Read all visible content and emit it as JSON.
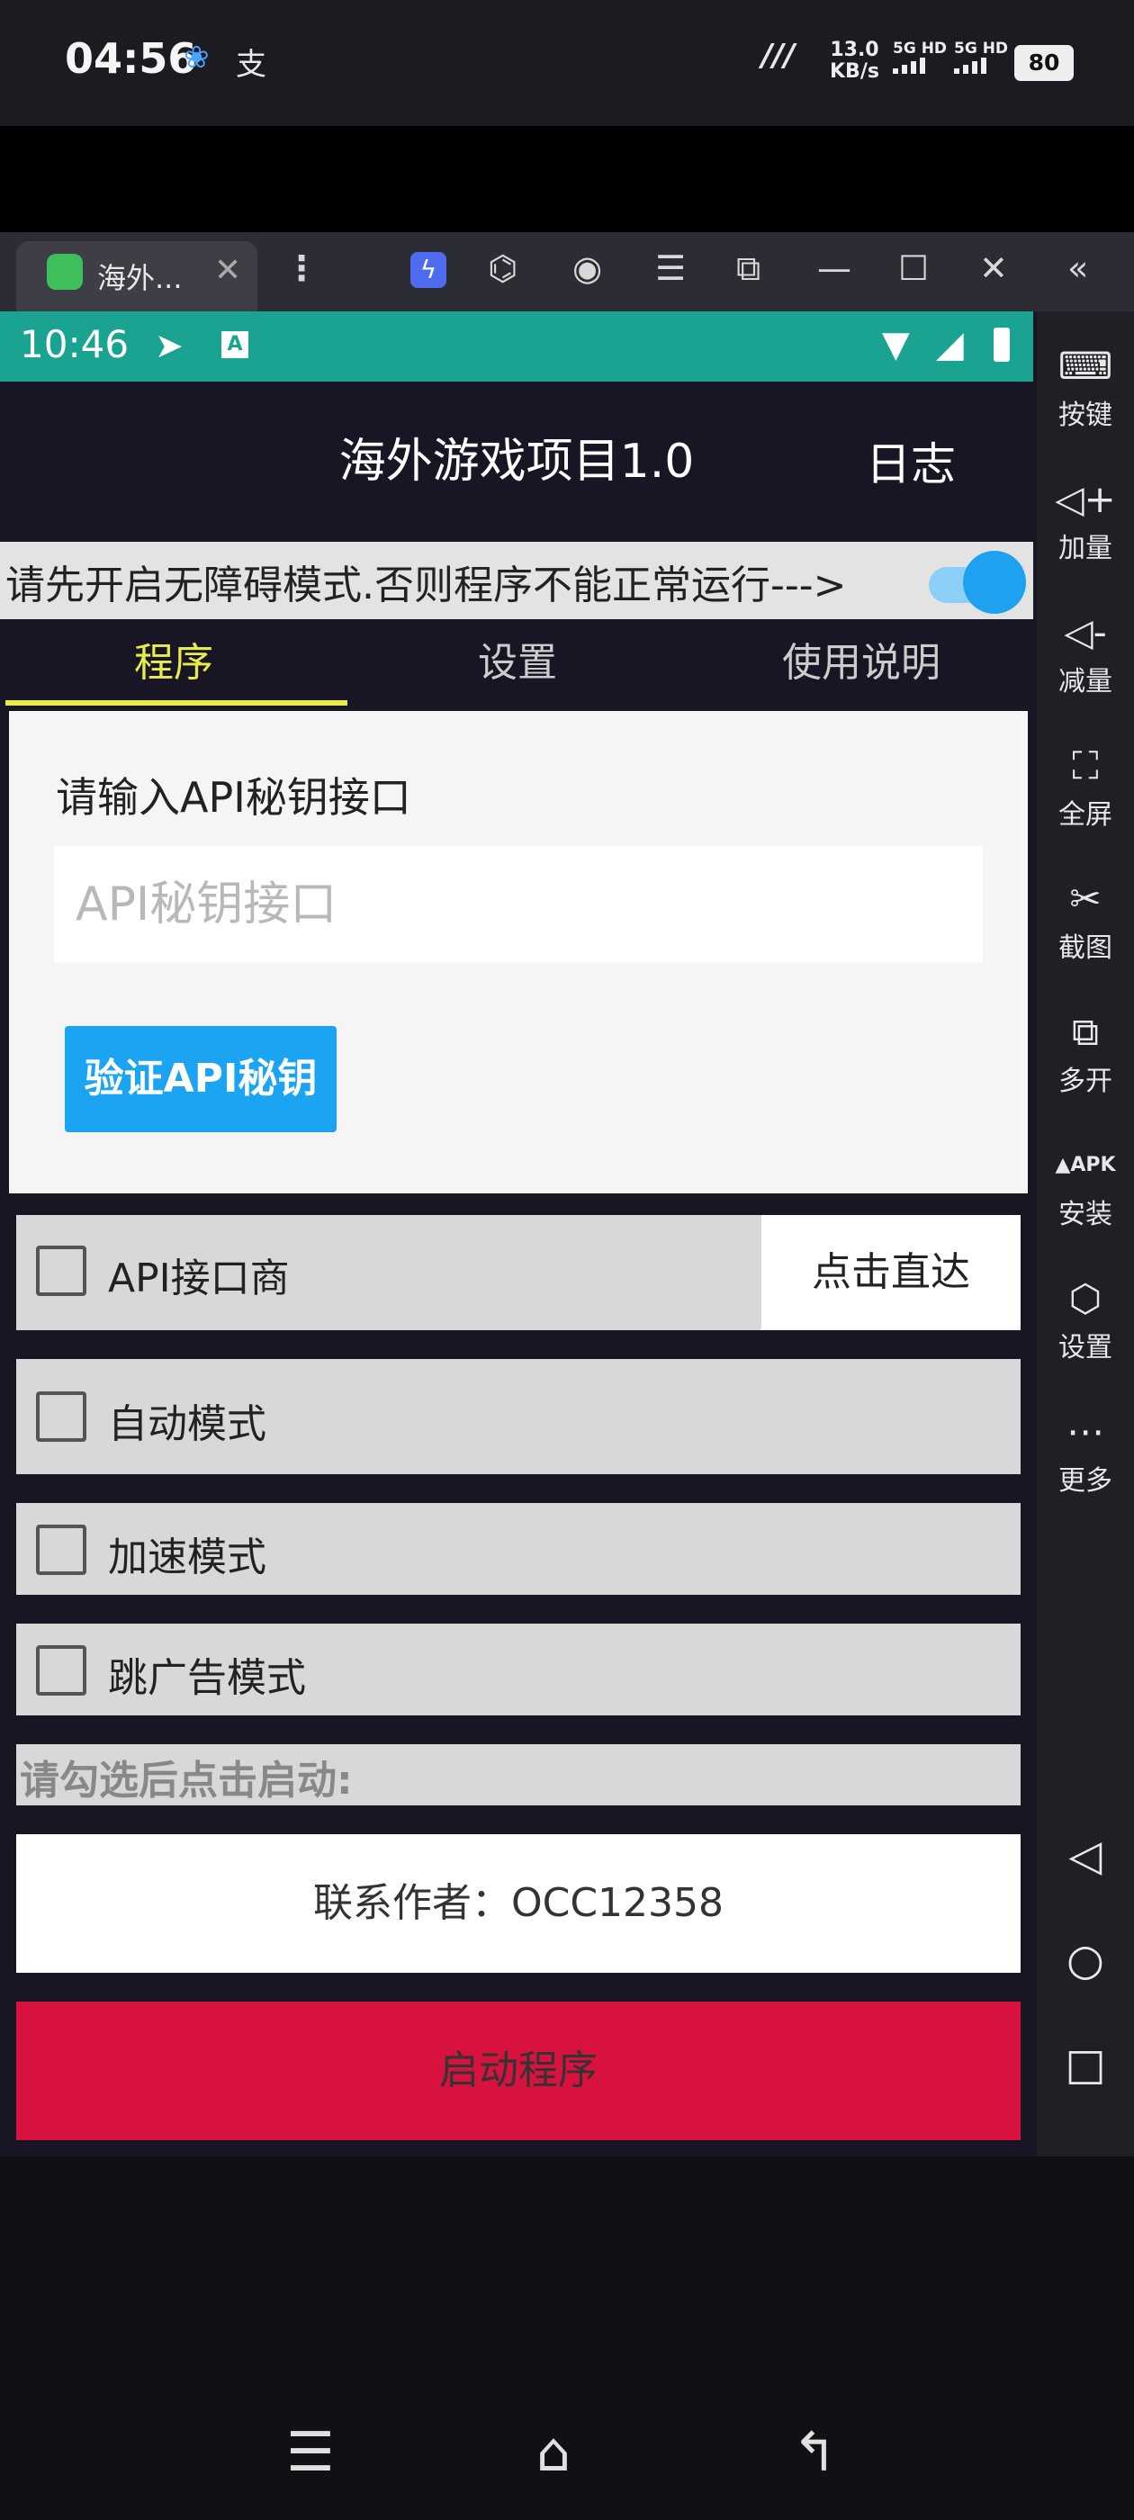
{
  "phone_status": {
    "time": "04:56",
    "speed_value": "13.0",
    "speed_unit": "KB/s",
    "sim1": "5G HD",
    "sim2": "5G HD",
    "battery": "80"
  },
  "emulator": {
    "tab_title": "海外...",
    "close": "✕",
    "menu": "⋮"
  },
  "android_status": {
    "time": "10:46"
  },
  "app": {
    "title": "海外游戏项目1.0",
    "log_link": "日志",
    "notice": "请先开启无障碍模式.否则程序不能正常运行--->",
    "accessibility_toggle": true,
    "tabs": [
      {
        "label": "程序",
        "active": true
      },
      {
        "label": "设置",
        "active": false
      },
      {
        "label": "使用说明",
        "active": false
      }
    ],
    "api_section": {
      "label": "请输入API秘钥接口",
      "placeholder": "API秘钥接口",
      "value": "",
      "verify_button": "验证API秘钥"
    },
    "options": [
      {
        "label": "API接口商",
        "checked": false
      },
      {
        "label": "自动模式",
        "checked": false
      },
      {
        "label": "加速模式",
        "checked": false
      },
      {
        "label": "跳广告模式",
        "checked": false
      }
    ],
    "goto_button": "点击直达",
    "hint": "请勾选后点击启动:",
    "contact_button": "联系作者：OCC12358",
    "start_button": "启动程序"
  },
  "sidebar": {
    "items": [
      {
        "label": "按键",
        "icon": "keyboard-icon"
      },
      {
        "label": "加量",
        "icon": "volume-up-icon"
      },
      {
        "label": "减量",
        "icon": "volume-down-icon"
      },
      {
        "label": "全屏",
        "icon": "fullscreen-icon"
      },
      {
        "label": "截图",
        "icon": "scissors-icon"
      },
      {
        "label": "多开",
        "icon": "multi-instance-icon"
      },
      {
        "label": "安装",
        "icon": "apk-install-icon"
      },
      {
        "label": "设置",
        "icon": "settings-icon"
      },
      {
        "label": "更多",
        "icon": "more-icon"
      }
    ]
  },
  "colors": {
    "status_teal": "#1aa391",
    "accent_blue": "#1ba4f2",
    "tab_indicator": "#e8ec4a",
    "start_red": "#d7123f"
  }
}
